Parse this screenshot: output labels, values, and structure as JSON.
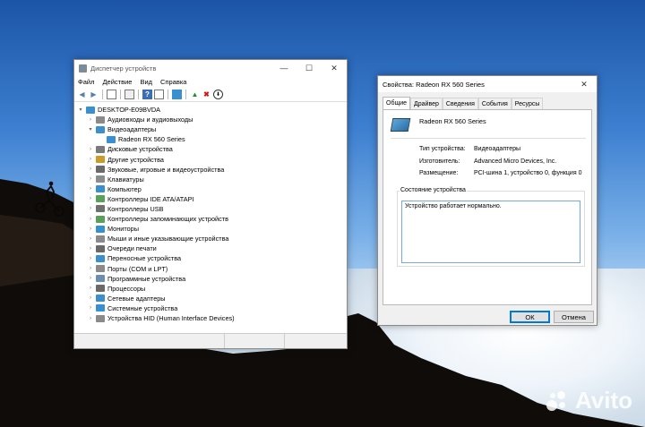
{
  "device_manager": {
    "title": "Диспетчер устройств",
    "menu": [
      "Файл",
      "Действие",
      "Вид",
      "Справка"
    ],
    "computer": "DESKTOP-E09BVDA",
    "categories": [
      {
        "label": "Аудиовходы и аудиовыходы",
        "icon": "speaker-icon",
        "color": "#8a8a8a",
        "expanded": false
      },
      {
        "label": "Видеоадаптеры",
        "icon": "display-adapter-icon",
        "color": "#3a8fd0",
        "expanded": true,
        "children": [
          "Radeon RX 560 Series"
        ]
      },
      {
        "label": "Дисковые устройства",
        "icon": "disk-icon",
        "color": "#7a7a7a",
        "expanded": false
      },
      {
        "label": "Другие устройства",
        "icon": "unknown-device-icon",
        "color": "#c99a2e",
        "expanded": false
      },
      {
        "label": "Звуковые, игровые и видеоустройства",
        "icon": "sound-icon",
        "color": "#6a6a6a",
        "expanded": false
      },
      {
        "label": "Клавиатуры",
        "icon": "keyboard-icon",
        "color": "#8c8c8c",
        "expanded": false
      },
      {
        "label": "Компьютер",
        "icon": "computer-icon",
        "color": "#3a8fd0",
        "expanded": false
      },
      {
        "label": "Контроллеры IDE ATA/ATAPI",
        "icon": "ide-controller-icon",
        "color": "#5aa05a",
        "expanded": false
      },
      {
        "label": "Контроллеры USB",
        "icon": "usb-icon",
        "color": "#707070",
        "expanded": false
      },
      {
        "label": "Контроллеры запоминающих устройств",
        "icon": "storage-controller-icon",
        "color": "#5aa05a",
        "expanded": false
      },
      {
        "label": "Мониторы",
        "icon": "monitor-icon",
        "color": "#3a8fd0",
        "expanded": false
      },
      {
        "label": "Мыши и иные указывающие устройства",
        "icon": "mouse-icon",
        "color": "#8a8a8a",
        "expanded": false
      },
      {
        "label": "Очереди печати",
        "icon": "printer-icon",
        "color": "#6a6a6a",
        "expanded": false
      },
      {
        "label": "Переносные устройства",
        "icon": "portable-device-icon",
        "color": "#3a8fd0",
        "expanded": false
      },
      {
        "label": "Порты (COM и LPT)",
        "icon": "port-icon",
        "color": "#8a8a8a",
        "expanded": false
      },
      {
        "label": "Программные устройства",
        "icon": "software-device-icon",
        "color": "#6a8fb0",
        "expanded": false
      },
      {
        "label": "Процессоры",
        "icon": "processor-icon",
        "color": "#6a6a6a",
        "expanded": false
      },
      {
        "label": "Сетевые адаптеры",
        "icon": "network-adapter-icon",
        "color": "#3a8fd0",
        "expanded": false
      },
      {
        "label": "Системные устройства",
        "icon": "system-device-icon",
        "color": "#3a8fd0",
        "expanded": false
      },
      {
        "label": "Устройства HID (Human Interface Devices)",
        "icon": "hid-icon",
        "color": "#8a8a8a",
        "expanded": false
      }
    ]
  },
  "properties": {
    "title": "Свойства: Radeon RX 560 Series",
    "tabs": [
      "Общие",
      "Драйвер",
      "Сведения",
      "События",
      "Ресурсы"
    ],
    "active_tab": "Общие",
    "device_name": "Radeon RX 560 Series",
    "fields": {
      "type_label": "Тип устройства:",
      "type_value": "Видеоадаптеры",
      "manufacturer_label": "Изготовитель:",
      "manufacturer_value": "Advanced Micro Devices, Inc.",
      "location_label": "Размещение:",
      "location_value": "PCI-шина 1, устройство 0, функция 0"
    },
    "status_group_label": "Состояние устройства",
    "status_text": "Устройство работает нормально.",
    "ok_label": "ОК",
    "cancel_label": "Отмена"
  },
  "watermark": "Avito"
}
